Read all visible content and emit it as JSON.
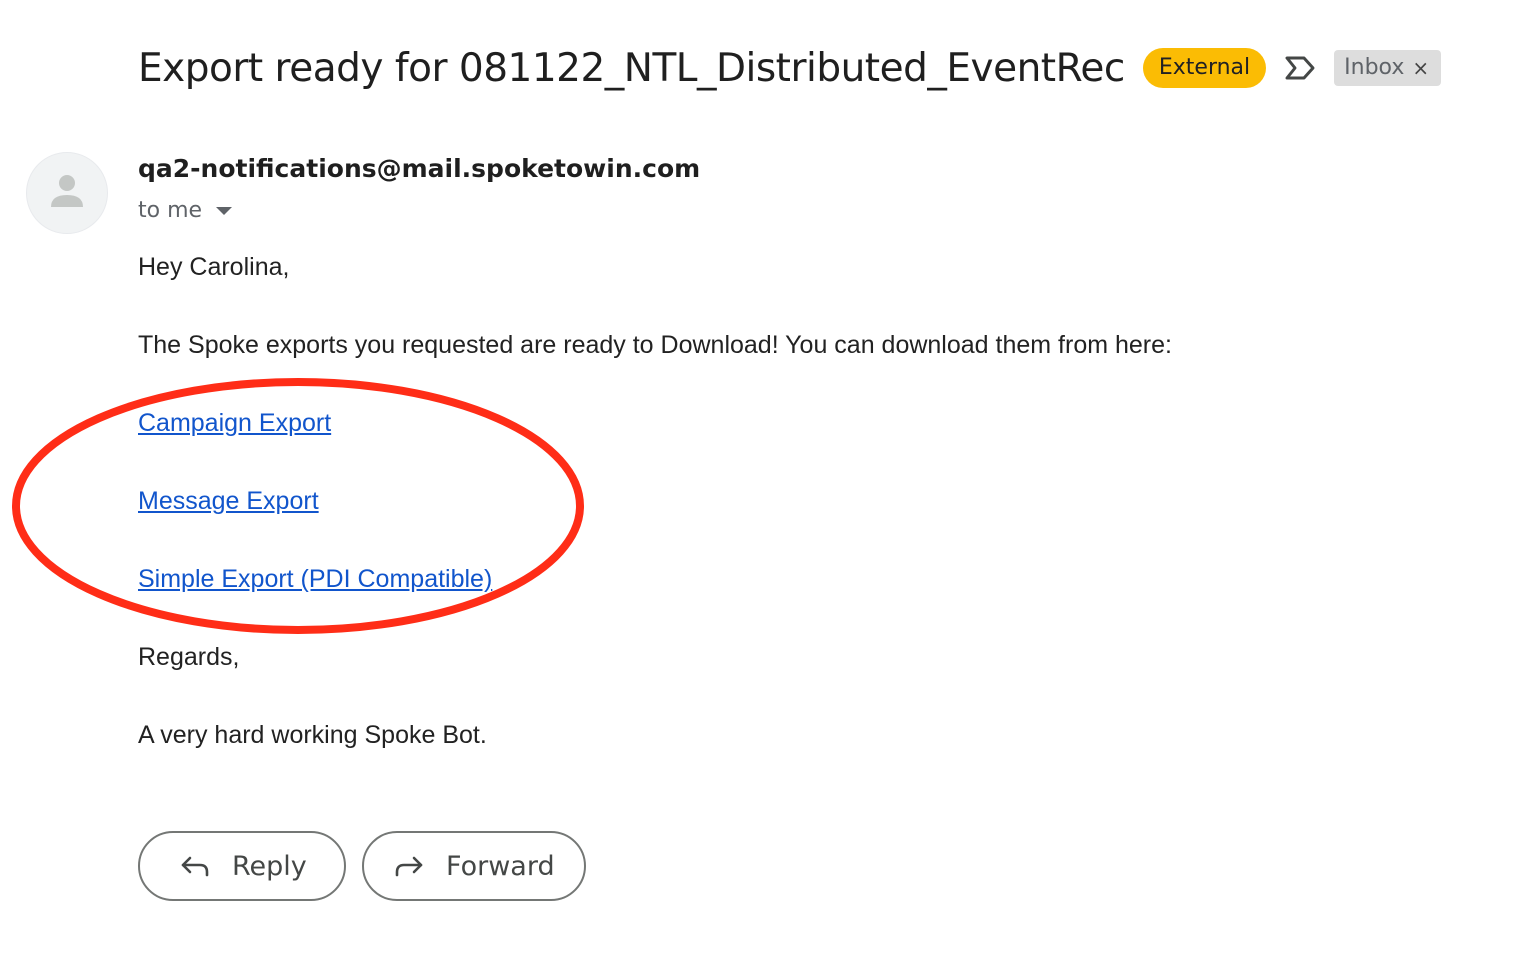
{
  "email": {
    "subject": "Export ready for 081122_NTL_Distributed_EventRec",
    "external_label": "External",
    "label_icon": "label-arrow-icon",
    "inbox_chip": "Inbox",
    "inbox_remove": "×",
    "sender": "qa2-notifications@mail.spoketowin.com",
    "to": "to me",
    "greeting": "Hey Carolina,",
    "intro": "The Spoke exports you requested are ready to Download! You can download them from here:",
    "links": {
      "campaign": "Campaign Export",
      "message": "Message Export",
      "simple": "Simple Export (PDI Compatible)"
    },
    "regards": "Regards,",
    "signature": "A very hard working Spoke Bot."
  },
  "actions": {
    "reply": "Reply",
    "forward": "Forward"
  },
  "colors": {
    "external_badge": "#fbbc04",
    "link": "#1155cc",
    "annotation": "#ff2d17"
  }
}
